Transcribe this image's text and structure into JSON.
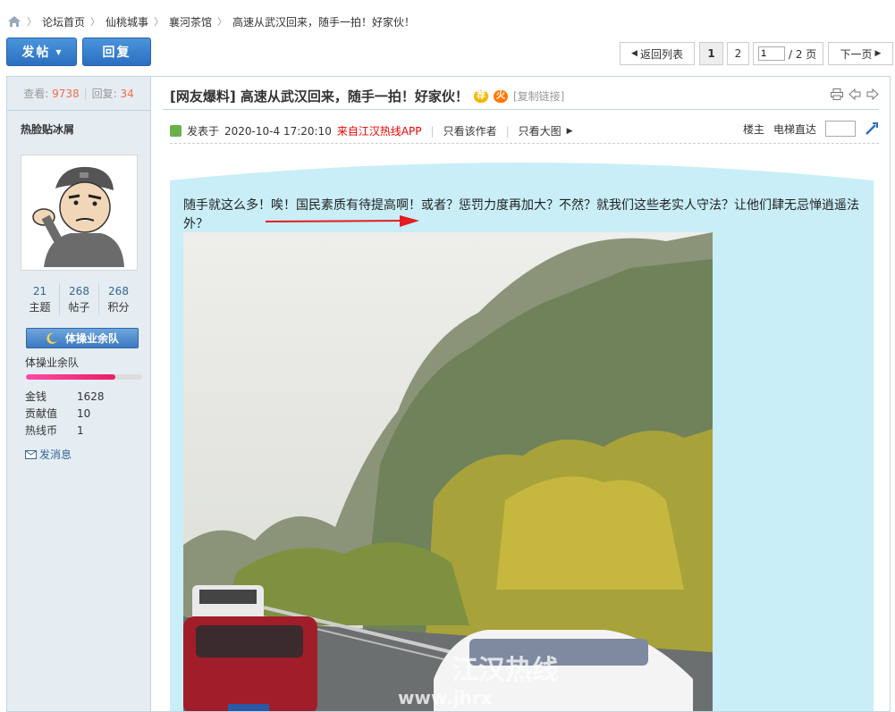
{
  "breadcrumb": {
    "items": [
      "论坛首页",
      "仙桃城事",
      "襄河茶馆",
      "高速从武汉回来，随手一拍！好家伙！"
    ]
  },
  "toolbar": {
    "post_label": "发帖",
    "reply_label": "回复"
  },
  "pager": {
    "back_label": "返回列表",
    "pages": [
      "1",
      "2"
    ],
    "input_value": "1",
    "total_label": "/ 2 页",
    "next_label": "下一页"
  },
  "thread": {
    "views_label": "查看:",
    "views": "9738",
    "replies_label": "回复:",
    "replies": "34",
    "title": "[网友爆料] 高速从武汉回来，随手一拍！好家伙！",
    "badge_recommend": "荐",
    "badge_hot": "火",
    "copy_link": "[复制链接]"
  },
  "author": {
    "name": "热脸贴冰屑",
    "threads": "21",
    "threads_label": "主题",
    "posts": "268",
    "posts_label": "帖子",
    "credits": "268",
    "credits_label": "积分",
    "group_badge": "体操业余队",
    "group_name": "体操业余队",
    "exp_fraction": 0.77,
    "money_label": "金钱",
    "money": "1628",
    "contrib_label": "贡献值",
    "contrib": "10",
    "coin_label": "热线币",
    "coin": "1",
    "send_msg": "发消息"
  },
  "post": {
    "posted_label": "发表于",
    "posted_time": "2020-10-4 17:20:10",
    "source": "来自江汉热线APP",
    "only_author": "只看该作者",
    "only_big_image": "只看大图",
    "floor_label": "楼主",
    "jump_label": "电梯直达",
    "body": "随手就这么多！唉！国民素质有待提高啊！或者？惩罚力度再加大？不然？就我们这些老实人守法？让他们肆无忌惮逍遥法外？",
    "watermark": "江汉热线",
    "watermark_url": "www.jhrx"
  },
  "colors": {
    "accent_blue": "#2a6fc0",
    "post_bg": "#c9eef7",
    "stat_number": "#f26c4f",
    "source_red": "#ee0000"
  }
}
